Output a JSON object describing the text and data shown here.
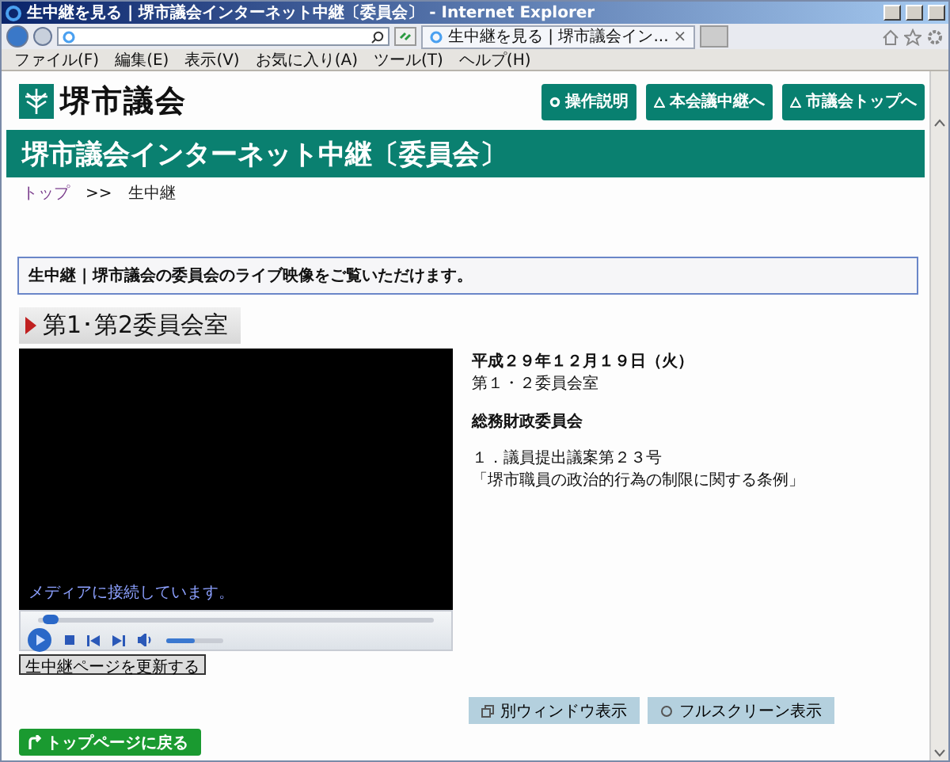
{
  "window": {
    "title": "生中継を見る | 堺市議会インターネット中継〔委員会〕 - Internet Explorer"
  },
  "browser": {
    "tab_title": "生中継を見る | 堺市議会イン...",
    "tab_close": "×",
    "menu": [
      "ファイル(F)",
      "編集(E)",
      "表示(V)",
      "お気に入り(A)",
      "ツール(T)",
      "ヘルプ(H)"
    ]
  },
  "header": {
    "logo_text": "堺市議会",
    "buttons": [
      {
        "label": "操作説明",
        "kind": "gear"
      },
      {
        "label": "本会議中継へ",
        "kind": "link"
      },
      {
        "label": "市議会トップへ",
        "kind": "link"
      }
    ]
  },
  "banner_title": "堺市議会インターネット中継〔委員会〕",
  "breadcrumb": {
    "items": [
      {
        "label": "トップ",
        "link": true
      },
      {
        "label": "生中継",
        "link": false
      }
    ],
    "separator": ">>"
  },
  "notice": "生中継 | 堺市議会の委員会のライブ映像をご覧いただけます。",
  "room_heading": "第1･第2委員会室",
  "player": {
    "status": "メディアに接続しています。",
    "seek": {
      "level": 0.03
    },
    "volume": {
      "level": 0.5
    }
  },
  "refresh_button": "生中継ページを更新する",
  "details": {
    "date": "平成２９年１２月１９日（火）",
    "room": "第１・２委員会室",
    "committee": "総務財政委員会",
    "item_number": "１．議員提出議案第２３号",
    "item_title": "「堺市職員の政治的行為の制限に関する条例」"
  },
  "view_buttons": [
    {
      "label": "別ウィンドウ表示",
      "kind": "window"
    },
    {
      "label": "フルスクリーン表示",
      "kind": "fullscreen"
    }
  ],
  "back_button": "トップページに戻る"
}
